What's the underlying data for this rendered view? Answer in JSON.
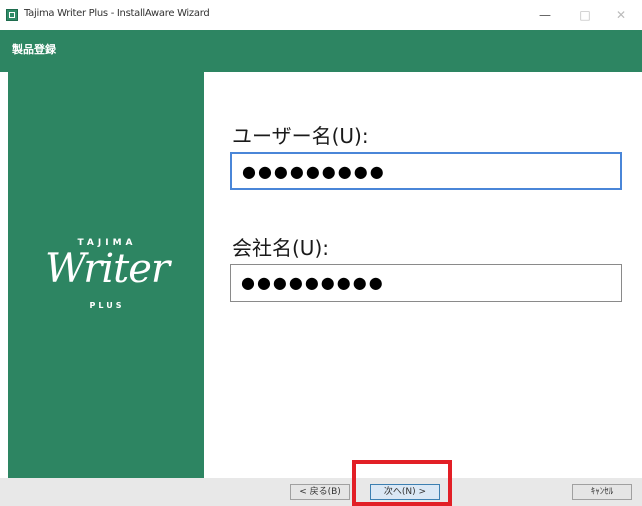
{
  "window": {
    "title": "Tajima Writer Plus - InstallAware Wizard",
    "minimize": "—",
    "maximize": "□",
    "close": "✕"
  },
  "header": {
    "title": "製品登録"
  },
  "logo": {
    "top": "TAJIMA",
    "script": "Writer",
    "bottom": "PLUS"
  },
  "form": {
    "username_label": "ユーザー名(U):",
    "username_value": "●●●●●●●●●",
    "company_label": "会社名(U):",
    "company_value": "●●●●●●●●●"
  },
  "footer": {
    "back_label": "< 戻る(B)",
    "next_label": "次へ(N) >",
    "cancel_label": "ｷｬﾝｾﾙ"
  },
  "colors": {
    "brand_green": "#2d8562",
    "highlight_red": "#e21f26",
    "focus_blue": "#4a86d8"
  }
}
